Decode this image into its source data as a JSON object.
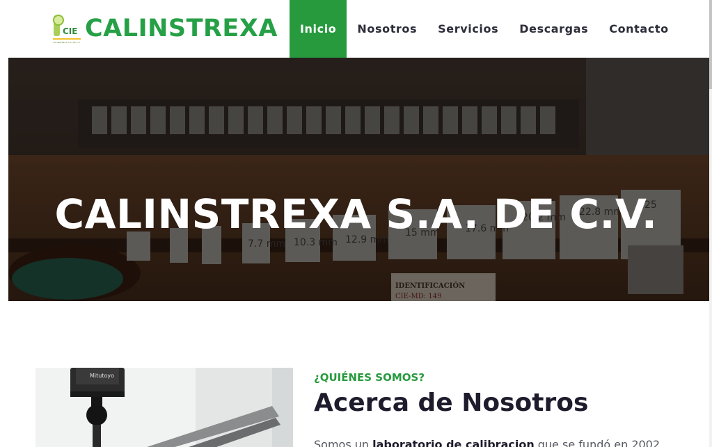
{
  "brand": {
    "name": "CALINSTREXA",
    "logo_initials": "CIE",
    "logo_tagline": "CALINSTREXA S.A. DE C.V."
  },
  "nav": {
    "items": [
      {
        "label": "Inicio",
        "active": true
      },
      {
        "label": "Nosotros",
        "active": false
      },
      {
        "label": "Servicios",
        "active": false
      },
      {
        "label": "Descargas",
        "active": false
      },
      {
        "label": "Contacto",
        "active": false
      }
    ]
  },
  "hero": {
    "title": "CALINSTREXA S.A. DE C.V.",
    "photo_labels": [
      "7.7 mm",
      "10.3 mm",
      "12.9 mm",
      "15 mm",
      "17.6 mm",
      "20.2 mm",
      "22.8 mm",
      "25"
    ],
    "tag_label": "IDENTIFICACIÓN",
    "tag_code": "CIE-MD: 149"
  },
  "about": {
    "kicker": "¿QUIÉNES SOMOS?",
    "title": "Acerca de Nosotros",
    "body_pre": "Somos un ",
    "body_bold": "laboratorio de calibracion",
    "body_post": " que se fundó en 2002",
    "photo_brand": "Mitutoyo"
  },
  "colors": {
    "accent": "#279a3e",
    "brand_text": "#26a046",
    "heading": "#1e1c2c"
  }
}
